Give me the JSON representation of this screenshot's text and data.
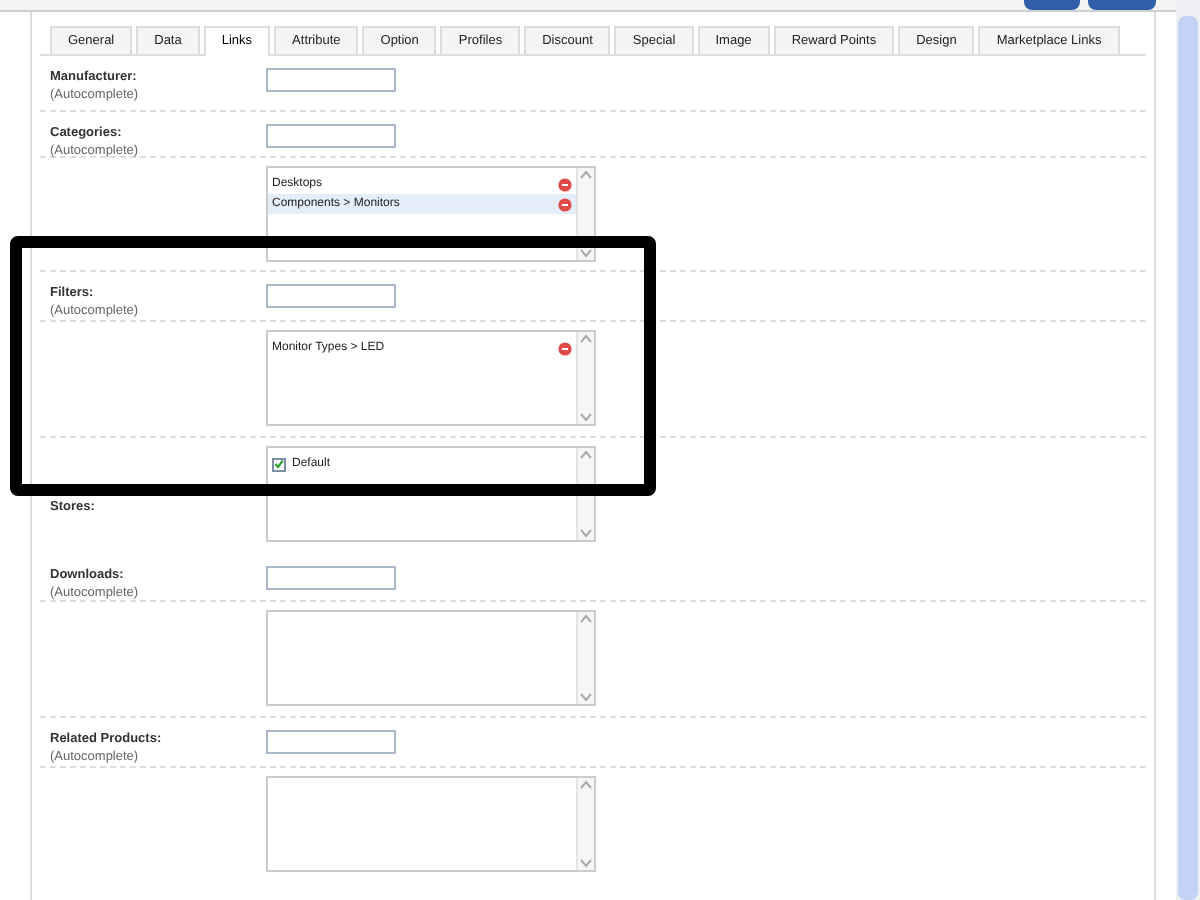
{
  "tabs": [
    {
      "label": "General",
      "selected": false
    },
    {
      "label": "Data",
      "selected": false
    },
    {
      "label": "Links",
      "selected": true
    },
    {
      "label": "Attribute",
      "selected": false
    },
    {
      "label": "Option",
      "selected": false
    },
    {
      "label": "Profiles",
      "selected": false
    },
    {
      "label": "Discount",
      "selected": false
    },
    {
      "label": "Special",
      "selected": false
    },
    {
      "label": "Image",
      "selected": false
    },
    {
      "label": "Reward Points",
      "selected": false
    },
    {
      "label": "Design",
      "selected": false
    },
    {
      "label": "Marketplace Links",
      "selected": false
    }
  ],
  "rows": [
    {
      "kind": "autocomplete",
      "label": "Manufacturer:",
      "note": "(Autocomplete)"
    },
    {
      "kind": "autocomplete",
      "label": "Categories:",
      "note": "(Autocomplete)"
    },
    {
      "kind": "list",
      "items": [
        {
          "label": "Desktops",
          "selected": false
        },
        {
          "label": "Components > Monitors",
          "selected": true
        }
      ]
    },
    {
      "kind": "autocomplete",
      "label": "Filters:",
      "note": "(Autocomplete)"
    },
    {
      "kind": "list",
      "items": [
        {
          "label": "Monitor Types > LED",
          "selected": false
        }
      ]
    },
    {
      "kind": "checklist",
      "label": "Stores:",
      "items": [
        {
          "label": "Default",
          "checked": true
        }
      ]
    },
    {
      "kind": "autocomplete",
      "label": "Downloads:",
      "note": "(Autocomplete)"
    },
    {
      "kind": "list",
      "items": []
    },
    {
      "kind": "autocomplete",
      "label": "Related Products:",
      "note": "(Autocomplete)"
    },
    {
      "kind": "list",
      "items": []
    }
  ]
}
